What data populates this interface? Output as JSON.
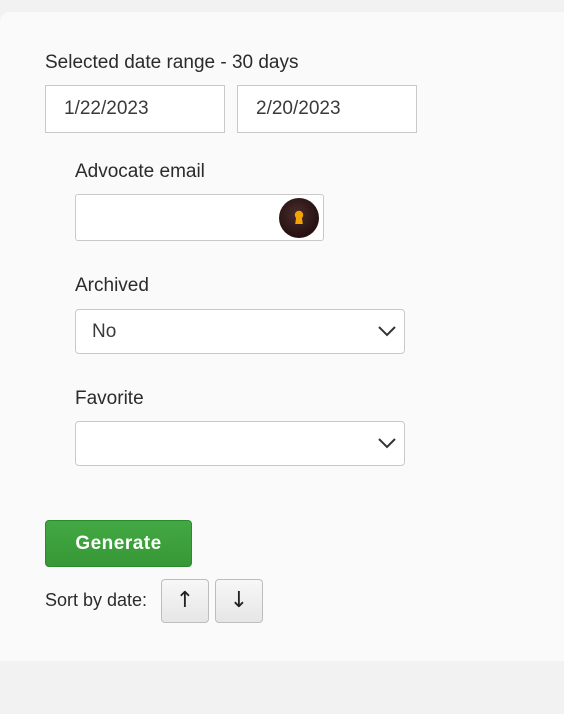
{
  "date_range": {
    "label": "Selected date range - 30 days",
    "start": "1/22/2023",
    "end": "2/20/2023"
  },
  "advocate_email": {
    "label": "Advocate email",
    "value": "",
    "icon": "keyhole-icon"
  },
  "archived": {
    "label": "Archived",
    "selected": "No",
    "icon": "chevron-down-icon"
  },
  "favorite": {
    "label": "Favorite",
    "selected": "",
    "icon": "chevron-down-icon"
  },
  "generate_button": {
    "label": "Generate",
    "color": "#3a9e3a"
  },
  "sort": {
    "label": "Sort by date:",
    "ascending_symbol": "↑",
    "descending_symbol": "↓"
  }
}
